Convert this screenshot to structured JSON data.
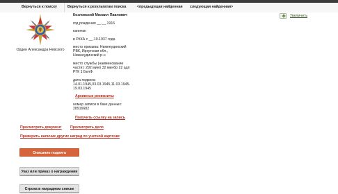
{
  "nav": {
    "back_to_search": "Вернуться к поиску",
    "back_to_results": "Вернуться к результатам поиска",
    "prev_found": "<предыдущая найденная",
    "next_found": "следующая найденная>"
  },
  "award": {
    "caption": "Орден Александра Невского",
    "zoom_label": "Увеличить"
  },
  "person": {
    "name": "Козловский Михаил Павлович",
    "birth": "год рождения __.__.1916",
    "rank": "капитан",
    "in_rkka": "в РККА с __.10.1937 года",
    "draft_place": [
      "место призыва: Нижнеудинский",
      "РВК, Иркутская обл.,",
      "Нижнеудинский р-н"
    ],
    "service_place": [
      "место службы (наименование",
      "части): 292 минп 32 минбр 22 адп",
      "РГК 1 БелФ"
    ],
    "feat_dates": [
      "дата подвига:",
      "14.01.1945,03.03.1945,11.03.1945-",
      "19.03.1945"
    ],
    "archive_link": "Архивные реквизиты",
    "record_number": [
      "номер записи в базе данных:",
      "28916682"
    ],
    "get_link": "Получить ссылку на запись"
  },
  "links": {
    "view_document": "Просмотреть документ",
    "view_case": "Просмотреть дело",
    "check_other_awards": "Проверить наличие других наград по учетной карточке"
  },
  "buttons": {
    "feat_description": "Описание подвига",
    "award_order": "Указ или приказ о награждении",
    "award_list_row": "Строка в наградном списке"
  },
  "colors": {
    "accent_red": "#b52e1e",
    "button_orange": "#d5643c",
    "topbar": "#3c3c3c"
  }
}
